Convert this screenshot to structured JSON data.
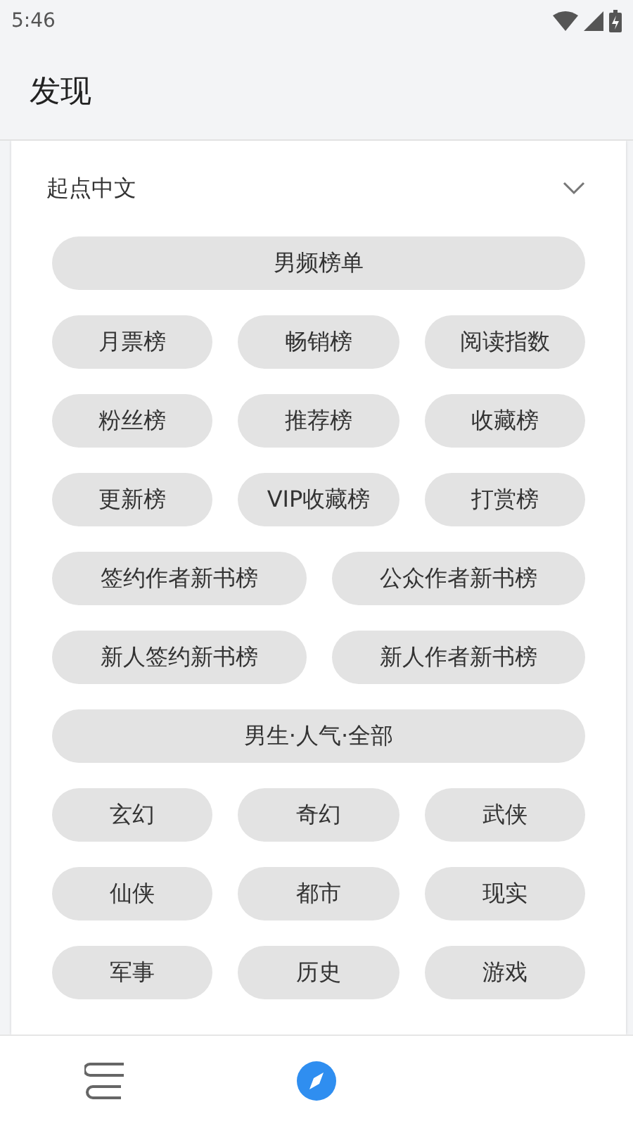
{
  "status_bar": {
    "time": "5:46"
  },
  "header": {
    "title": "发现"
  },
  "section": {
    "title": "起点中文",
    "expanded": true,
    "rows": [
      [
        "男频榜单"
      ],
      [
        "月票榜",
        "畅销榜",
        "阅读指数"
      ],
      [
        "粉丝榜",
        "推荐榜",
        "收藏榜"
      ],
      [
        "更新榜",
        "VIP收藏榜",
        "打赏榜"
      ],
      [
        "签约作者新书榜",
        "公众作者新书榜"
      ],
      [
        "新人签约新书榜",
        "新人作者新书榜"
      ],
      [
        "男生·人气·全部"
      ],
      [
        "玄幻",
        "奇幻",
        "武侠"
      ],
      [
        "仙侠",
        "都市",
        "现实"
      ],
      [
        "军事",
        "历史",
        "游戏"
      ]
    ]
  },
  "bottom_nav": [
    {
      "kind": "bookshelf",
      "selected": false
    },
    {
      "kind": "discover",
      "selected": true
    }
  ]
}
